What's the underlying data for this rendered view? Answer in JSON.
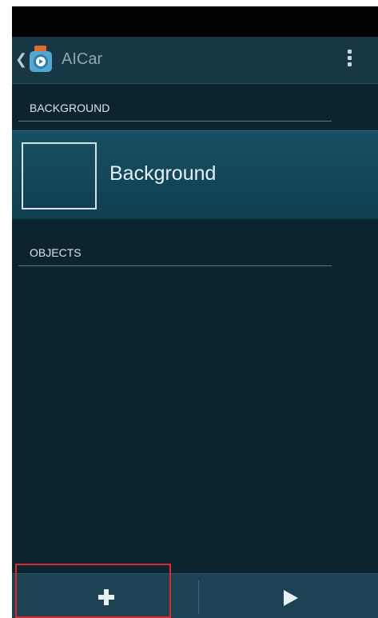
{
  "action_bar": {
    "title": "AICar",
    "up_icon": "chevron-left",
    "app_icon": "app-logo-icon",
    "overflow_icon": "vertical-dots-icon"
  },
  "sections": {
    "background_header": "BACKGROUND",
    "objects_header": "OBJECTS"
  },
  "background_item": {
    "label": "Background"
  },
  "bottom_bar": {
    "add_icon": "plus-icon",
    "play_icon": "play-icon"
  },
  "colors": {
    "screen_bg": "#0c2430",
    "action_bar": "#173744",
    "selected_item": "#175063",
    "bottom_bar": "#1d4253",
    "highlight": "#e0292e"
  }
}
